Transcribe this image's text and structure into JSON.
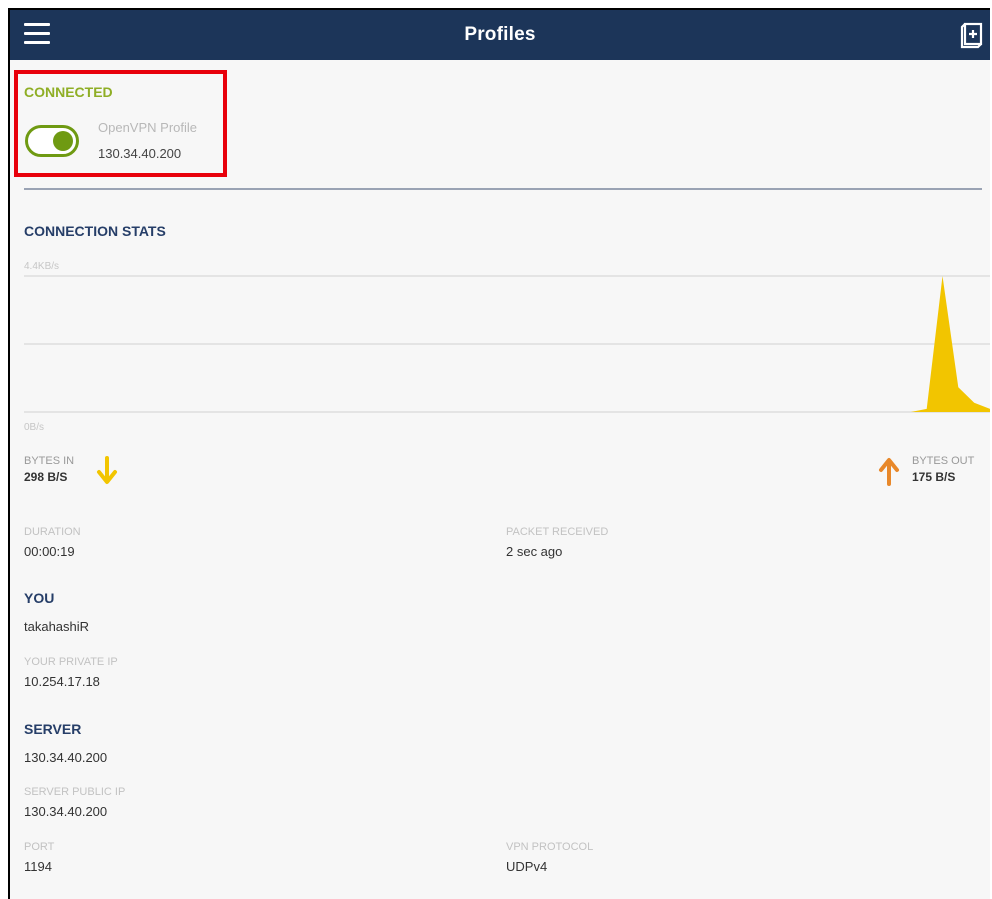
{
  "header": {
    "title": "Profiles",
    "menu_icon": "hamburger-menu-icon",
    "action_icon": "import-profile-icon"
  },
  "status": {
    "label": "CONNECTED",
    "color": "#8fae25"
  },
  "profile": {
    "name": "OpenVPN Profile",
    "ip": "130.34.40.200",
    "toggle_on": true
  },
  "stats": {
    "section_title": "CONNECTION STATS",
    "chart_data": {
      "type": "area",
      "y_max_label": "4.4KB/s",
      "y_min_label": "0B/s",
      "ylim": [
        0,
        4.4
      ],
      "values": [
        0,
        0,
        0,
        0,
        0,
        0,
        0,
        0,
        0,
        0,
        0,
        0,
        0,
        0,
        0,
        0,
        0,
        0,
        0,
        0,
        0,
        0,
        0,
        0,
        0,
        0,
        0,
        0,
        0,
        0,
        0,
        0,
        0,
        0,
        0,
        0,
        0,
        0,
        0,
        0,
        0,
        0,
        0,
        0,
        0,
        0,
        0,
        0,
        0,
        0,
        0,
        0,
        0,
        0,
        0,
        0,
        0,
        0.1,
        4.4,
        0.8,
        0.3,
        0.1
      ],
      "fill_color": "#f2c500",
      "grid": true
    },
    "bytes_in": {
      "label": "BYTES IN",
      "value": "298 B/S",
      "color": "#f2c500"
    },
    "bytes_out": {
      "label": "BYTES OUT",
      "value": "175 B/S",
      "color": "#e8882a"
    }
  },
  "details": {
    "duration": {
      "label": "DURATION",
      "value": "00:00:19"
    },
    "packet_received": {
      "label": "PACKET RECEIVED",
      "value": "2 sec ago"
    }
  },
  "you": {
    "title": "YOU",
    "username": "takahashiR",
    "private_ip": {
      "label": "YOUR PRIVATE IP",
      "value": "10.254.17.18"
    }
  },
  "server": {
    "title": "SERVER",
    "hostname": "130.34.40.200",
    "public_ip": {
      "label": "SERVER PUBLIC IP",
      "value": "130.34.40.200"
    },
    "port": {
      "label": "PORT",
      "value": "1194"
    },
    "protocol": {
      "label": "VPN PROTOCOL",
      "value": "UDPv4"
    }
  }
}
